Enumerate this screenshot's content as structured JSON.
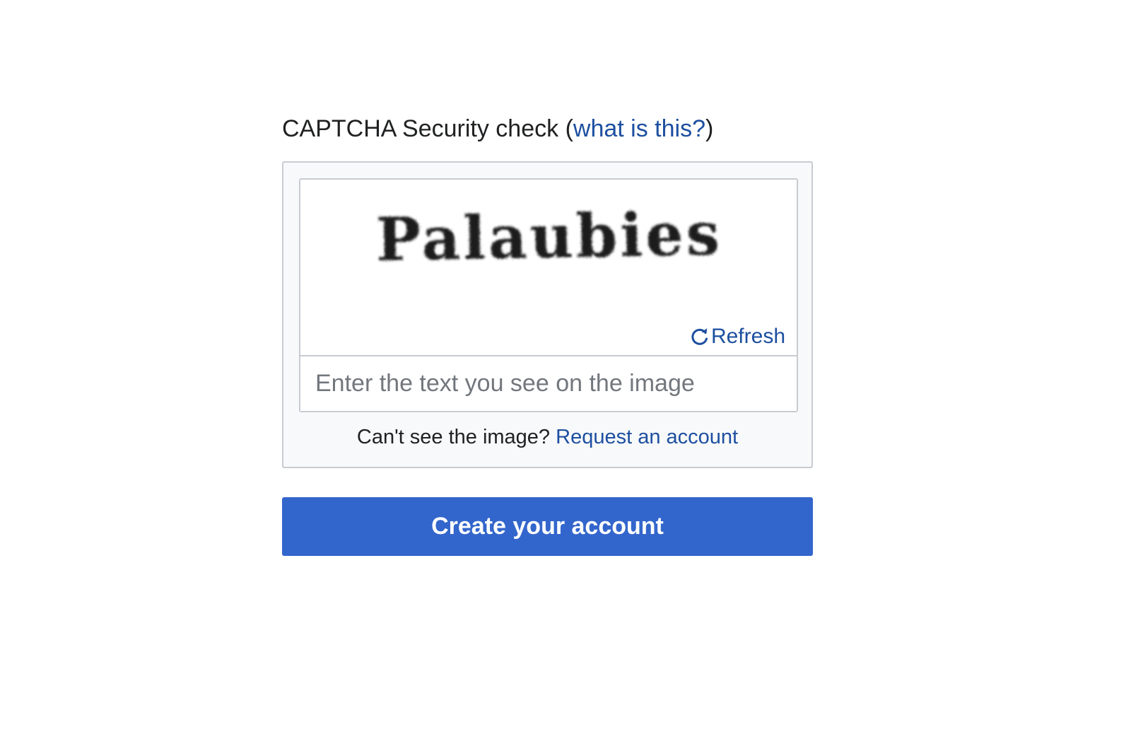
{
  "captcha": {
    "heading_text": "CAPTCHA Security check (",
    "heading_link": "what is this?",
    "heading_close": ")",
    "image_text": "Palaubies",
    "refresh_label": "Refresh",
    "refresh_icon": "refresh-icon",
    "input_value": "",
    "input_placeholder": "Enter the text you see on the image",
    "help_text": "Can't see the image? ",
    "help_link": "Request an account"
  },
  "form": {
    "submit_label": "Create your account"
  },
  "colors": {
    "link": "#1d4fa0",
    "button": "#3366cc",
    "box_background": "#f8f9fa",
    "border": "#c8ccd1"
  }
}
